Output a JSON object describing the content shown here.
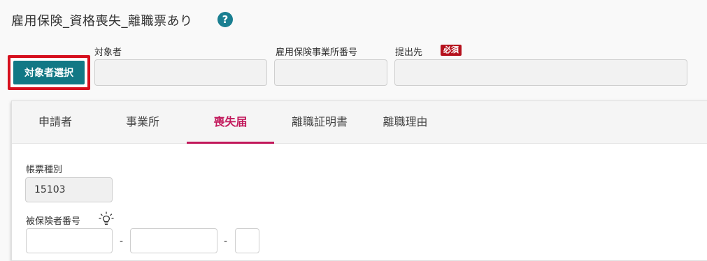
{
  "page": {
    "title": "雇用保険_資格喪失_離職票あり",
    "help_icon": "?"
  },
  "header": {
    "select_button_label": "対象者選択",
    "target_label": "対象者",
    "office_number_label": "雇用保険事業所番号",
    "submit_to_label": "提出先",
    "required_badge": "必須",
    "target_value": "",
    "office_number_value": "",
    "submit_to_value": ""
  },
  "tabs": [
    {
      "label": "申請者",
      "active": false
    },
    {
      "label": "事業所",
      "active": false
    },
    {
      "label": "喪失届",
      "active": true
    },
    {
      "label": "離職証明書",
      "active": false
    },
    {
      "label": "離職理由",
      "active": false
    }
  ],
  "form": {
    "form_type_label": "帳票種別",
    "form_type_value": "15103",
    "insured_number_label": "被保険者番号",
    "hint_icon": "lightbulb-icon",
    "separator": "-"
  },
  "colors": {
    "accent_teal": "#127885",
    "highlight_red": "#d6101e",
    "active_tab": "#c2185b",
    "required_badge": "#b5111d"
  }
}
